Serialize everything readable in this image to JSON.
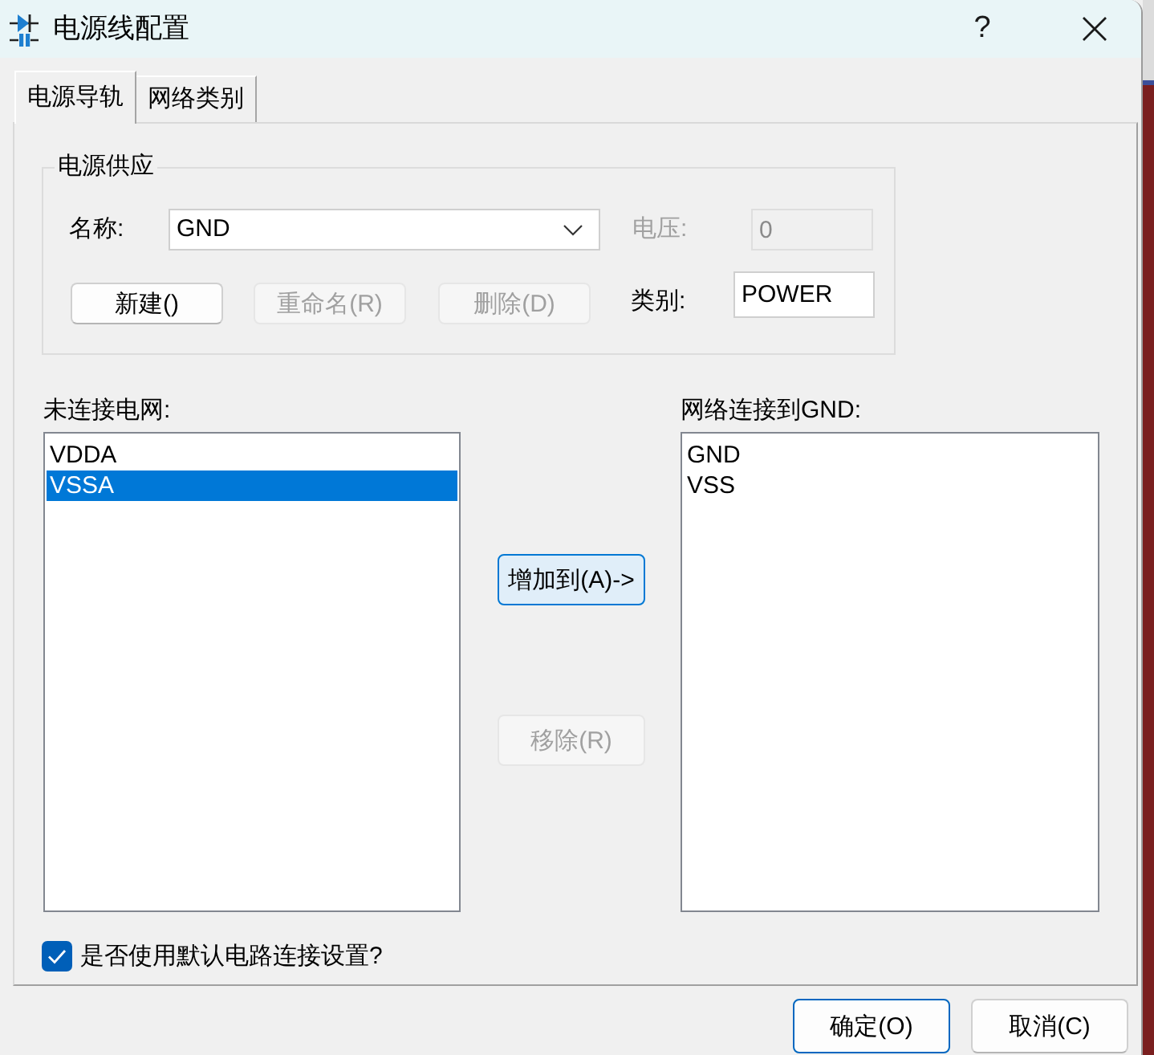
{
  "window": {
    "title": "电源线配置",
    "help": "?"
  },
  "tabs": [
    {
      "label": "电源导轨",
      "selected": true
    },
    {
      "label": "网络类别",
      "selected": false
    }
  ],
  "power_supply": {
    "title": "电源供应",
    "name": {
      "label": "名称:",
      "value": "GND"
    },
    "voltage": {
      "label": "电压:",
      "value": "0",
      "disabled": true
    },
    "buttons": [
      {
        "label": "新建()",
        "disabled": false
      },
      {
        "label": "重命名(R)",
        "disabled": true
      },
      {
        "label": "删除(D)",
        "disabled": true
      }
    ],
    "class": {
      "label": "类别:",
      "value": "POWER"
    }
  },
  "unconnected": {
    "label": "未连接电网:",
    "items": [
      {
        "text": "VDDA",
        "selected": false
      },
      {
        "text": "VSSA",
        "selected": true
      }
    ]
  },
  "actions": [
    {
      "label": "增加到(A)->",
      "disabled": false,
      "focused": true
    },
    {
      "label": "移除(R)",
      "disabled": true,
      "focused": false
    }
  ],
  "connected": {
    "label": "网络连接到GND:",
    "items": [
      {
        "text": "GND",
        "selected": false
      },
      {
        "text": "VSS",
        "selected": false
      }
    ]
  },
  "use_default": {
    "label": "是否使用默认电路连接设置?",
    "checked": true
  },
  "dialog_buttons": [
    {
      "label": "确定(O)",
      "default": true
    },
    {
      "label": "取消(C)",
      "default": false
    }
  ]
}
